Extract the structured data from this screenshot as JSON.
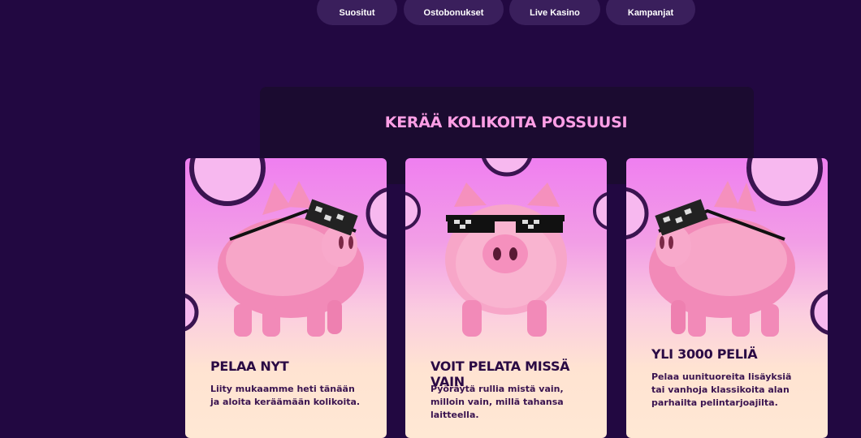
{
  "nav": {
    "items": [
      {
        "label": "Suositut"
      },
      {
        "label": "Ostobonukset"
      },
      {
        "label": "Live Kasino"
      },
      {
        "label": "Kampanjat"
      }
    ]
  },
  "section": {
    "title": "KERÄÄ KOLIKOITA POSSUUSI"
  },
  "cards": [
    {
      "title": "PELAA NYT",
      "text": "Liity mukaamme heti tänään ja aloita keräämään kolikoita."
    },
    {
      "title": "VOIT PELATA MISSÄ VAIN",
      "text": "Pyöräytä rullia mistä vain, milloin vain, millä tahansa laitteella."
    },
    {
      "title": "YLI 3000 PELIÄ",
      "text": "Pelaa uunituoreita lisäyksiä tai vanhoja klassikoita alan parhailta pelintarjoajilta."
    }
  ],
  "colors": {
    "background": "#220841",
    "pill": "#3a1f5c",
    "heading": "#ff9fe6",
    "card_title": "#2a0a44"
  }
}
